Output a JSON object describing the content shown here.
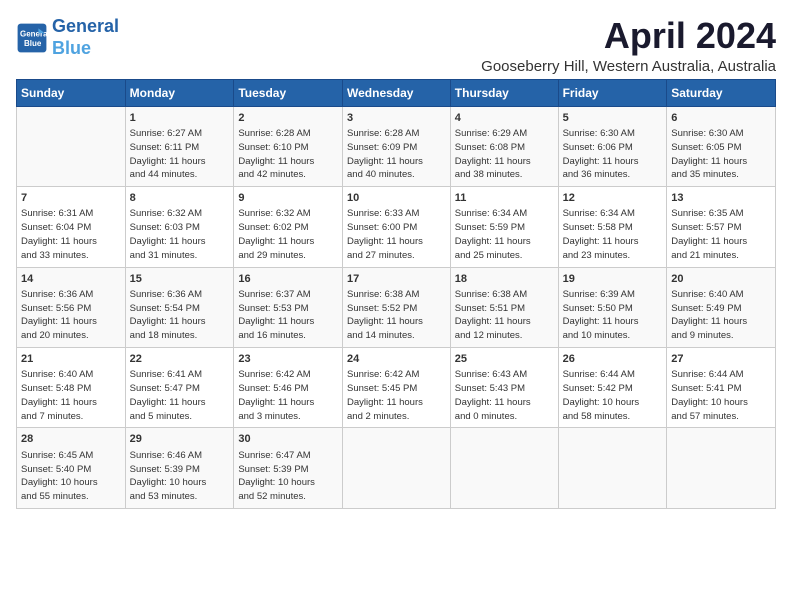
{
  "header": {
    "logo_line1": "General",
    "logo_line2": "Blue",
    "month": "April 2024",
    "location": "Gooseberry Hill, Western Australia, Australia"
  },
  "weekdays": [
    "Sunday",
    "Monday",
    "Tuesday",
    "Wednesday",
    "Thursday",
    "Friday",
    "Saturday"
  ],
  "weeks": [
    [
      {
        "day": "",
        "content": ""
      },
      {
        "day": "1",
        "content": "Sunrise: 6:27 AM\nSunset: 6:11 PM\nDaylight: 11 hours\nand 44 minutes."
      },
      {
        "day": "2",
        "content": "Sunrise: 6:28 AM\nSunset: 6:10 PM\nDaylight: 11 hours\nand 42 minutes."
      },
      {
        "day": "3",
        "content": "Sunrise: 6:28 AM\nSunset: 6:09 PM\nDaylight: 11 hours\nand 40 minutes."
      },
      {
        "day": "4",
        "content": "Sunrise: 6:29 AM\nSunset: 6:08 PM\nDaylight: 11 hours\nand 38 minutes."
      },
      {
        "day": "5",
        "content": "Sunrise: 6:30 AM\nSunset: 6:06 PM\nDaylight: 11 hours\nand 36 minutes."
      },
      {
        "day": "6",
        "content": "Sunrise: 6:30 AM\nSunset: 6:05 PM\nDaylight: 11 hours\nand 35 minutes."
      }
    ],
    [
      {
        "day": "7",
        "content": "Sunrise: 6:31 AM\nSunset: 6:04 PM\nDaylight: 11 hours\nand 33 minutes."
      },
      {
        "day": "8",
        "content": "Sunrise: 6:32 AM\nSunset: 6:03 PM\nDaylight: 11 hours\nand 31 minutes."
      },
      {
        "day": "9",
        "content": "Sunrise: 6:32 AM\nSunset: 6:02 PM\nDaylight: 11 hours\nand 29 minutes."
      },
      {
        "day": "10",
        "content": "Sunrise: 6:33 AM\nSunset: 6:00 PM\nDaylight: 11 hours\nand 27 minutes."
      },
      {
        "day": "11",
        "content": "Sunrise: 6:34 AM\nSunset: 5:59 PM\nDaylight: 11 hours\nand 25 minutes."
      },
      {
        "day": "12",
        "content": "Sunrise: 6:34 AM\nSunset: 5:58 PM\nDaylight: 11 hours\nand 23 minutes."
      },
      {
        "day": "13",
        "content": "Sunrise: 6:35 AM\nSunset: 5:57 PM\nDaylight: 11 hours\nand 21 minutes."
      }
    ],
    [
      {
        "day": "14",
        "content": "Sunrise: 6:36 AM\nSunset: 5:56 PM\nDaylight: 11 hours\nand 20 minutes."
      },
      {
        "day": "15",
        "content": "Sunrise: 6:36 AM\nSunset: 5:54 PM\nDaylight: 11 hours\nand 18 minutes."
      },
      {
        "day": "16",
        "content": "Sunrise: 6:37 AM\nSunset: 5:53 PM\nDaylight: 11 hours\nand 16 minutes."
      },
      {
        "day": "17",
        "content": "Sunrise: 6:38 AM\nSunset: 5:52 PM\nDaylight: 11 hours\nand 14 minutes."
      },
      {
        "day": "18",
        "content": "Sunrise: 6:38 AM\nSunset: 5:51 PM\nDaylight: 11 hours\nand 12 minutes."
      },
      {
        "day": "19",
        "content": "Sunrise: 6:39 AM\nSunset: 5:50 PM\nDaylight: 11 hours\nand 10 minutes."
      },
      {
        "day": "20",
        "content": "Sunrise: 6:40 AM\nSunset: 5:49 PM\nDaylight: 11 hours\nand 9 minutes."
      }
    ],
    [
      {
        "day": "21",
        "content": "Sunrise: 6:40 AM\nSunset: 5:48 PM\nDaylight: 11 hours\nand 7 minutes."
      },
      {
        "day": "22",
        "content": "Sunrise: 6:41 AM\nSunset: 5:47 PM\nDaylight: 11 hours\nand 5 minutes."
      },
      {
        "day": "23",
        "content": "Sunrise: 6:42 AM\nSunset: 5:46 PM\nDaylight: 11 hours\nand 3 minutes."
      },
      {
        "day": "24",
        "content": "Sunrise: 6:42 AM\nSunset: 5:45 PM\nDaylight: 11 hours\nand 2 minutes."
      },
      {
        "day": "25",
        "content": "Sunrise: 6:43 AM\nSunset: 5:43 PM\nDaylight: 11 hours\nand 0 minutes."
      },
      {
        "day": "26",
        "content": "Sunrise: 6:44 AM\nSunset: 5:42 PM\nDaylight: 10 hours\nand 58 minutes."
      },
      {
        "day": "27",
        "content": "Sunrise: 6:44 AM\nSunset: 5:41 PM\nDaylight: 10 hours\nand 57 minutes."
      }
    ],
    [
      {
        "day": "28",
        "content": "Sunrise: 6:45 AM\nSunset: 5:40 PM\nDaylight: 10 hours\nand 55 minutes."
      },
      {
        "day": "29",
        "content": "Sunrise: 6:46 AM\nSunset: 5:39 PM\nDaylight: 10 hours\nand 53 minutes."
      },
      {
        "day": "30",
        "content": "Sunrise: 6:47 AM\nSunset: 5:39 PM\nDaylight: 10 hours\nand 52 minutes."
      },
      {
        "day": "",
        "content": ""
      },
      {
        "day": "",
        "content": ""
      },
      {
        "day": "",
        "content": ""
      },
      {
        "day": "",
        "content": ""
      }
    ]
  ]
}
